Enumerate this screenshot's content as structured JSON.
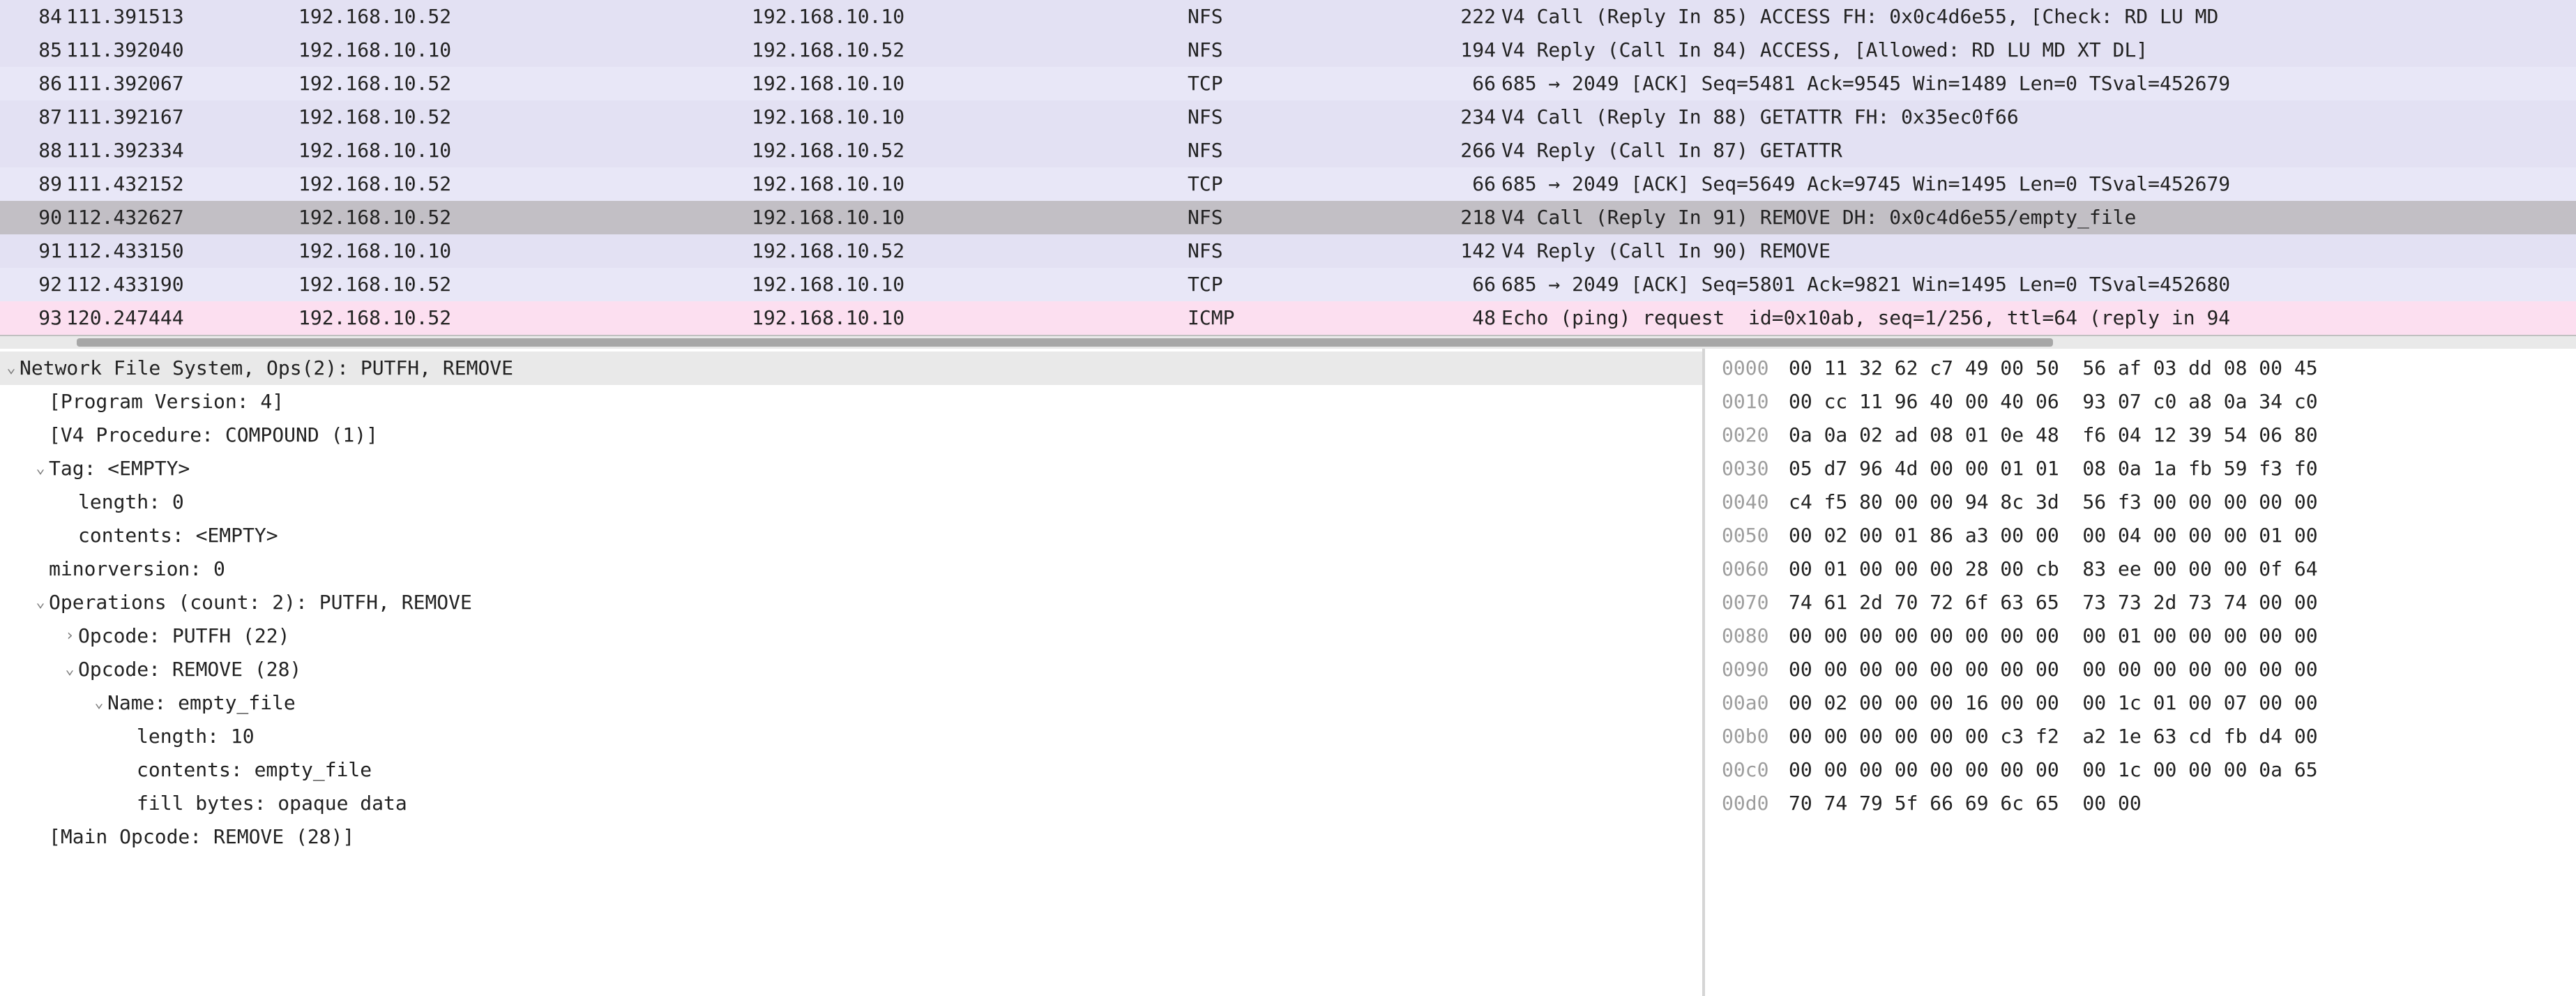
{
  "packets": [
    {
      "no": "84",
      "time": "111.391513",
      "src": "192.168.10.52",
      "dst": "192.168.10.10",
      "proto": "NFS",
      "len": "222",
      "info": "V4 Call (Reply In 85) ACCESS FH: 0x0c4d6e55, [Check: RD LU MD",
      "class": "nfs"
    },
    {
      "no": "85",
      "time": "111.392040",
      "src": "192.168.10.10",
      "dst": "192.168.10.52",
      "proto": "NFS",
      "len": "194",
      "info": "V4 Reply (Call In 84) ACCESS, [Allowed: RD LU MD XT DL]",
      "class": "nfs"
    },
    {
      "no": "86",
      "time": "111.392067",
      "src": "192.168.10.52",
      "dst": "192.168.10.10",
      "proto": "TCP",
      "len": "66",
      "info": "685 → 2049 [ACK] Seq=5481 Ack=9545 Win=1489 Len=0 TSval=452679",
      "class": "tcp"
    },
    {
      "no": "87",
      "time": "111.392167",
      "src": "192.168.10.52",
      "dst": "192.168.10.10",
      "proto": "NFS",
      "len": "234",
      "info": "V4 Call (Reply In 88) GETATTR FH: 0x35ec0f66",
      "class": "nfs"
    },
    {
      "no": "88",
      "time": "111.392334",
      "src": "192.168.10.10",
      "dst": "192.168.10.52",
      "proto": "NFS",
      "len": "266",
      "info": "V4 Reply (Call In 87) GETATTR",
      "class": "nfs"
    },
    {
      "no": "89",
      "time": "111.432152",
      "src": "192.168.10.52",
      "dst": "192.168.10.10",
      "proto": "TCP",
      "len": "66",
      "info": "685 → 2049 [ACK] Seq=5649 Ack=9745 Win=1495 Len=0 TSval=452679",
      "class": "tcp"
    },
    {
      "no": "90",
      "time": "112.432627",
      "src": "192.168.10.52",
      "dst": "192.168.10.10",
      "proto": "NFS",
      "len": "218",
      "info": "V4 Call (Reply In 91) REMOVE DH: 0x0c4d6e55/empty_file",
      "class": "selected"
    },
    {
      "no": "91",
      "time": "112.433150",
      "src": "192.168.10.10",
      "dst": "192.168.10.52",
      "proto": "NFS",
      "len": "142",
      "info": "V4 Reply (Call In 90) REMOVE",
      "class": "nfs"
    },
    {
      "no": "92",
      "time": "112.433190",
      "src": "192.168.10.52",
      "dst": "192.168.10.10",
      "proto": "TCP",
      "len": "66",
      "info": "685 → 2049 [ACK] Seq=5801 Ack=9821 Win=1495 Len=0 TSval=452680",
      "class": "tcp"
    },
    {
      "no": "93",
      "time": "120.247444",
      "src": "192.168.10.52",
      "dst": "192.168.10.10",
      "proto": "ICMP",
      "len": "48",
      "info": "Echo (ping) request  id=0x10ab, seq=1/256, ttl=64 (reply in 94",
      "class": "icmp"
    }
  ],
  "tree": [
    {
      "indent": 0,
      "caret": "down",
      "sel": true,
      "text": "Network File System, Ops(2): PUTFH, REMOVE"
    },
    {
      "indent": 1,
      "caret": "none",
      "sel": false,
      "text": "[Program Version: 4]"
    },
    {
      "indent": 1,
      "caret": "none",
      "sel": false,
      "text": "[V4 Procedure: COMPOUND (1)]"
    },
    {
      "indent": 1,
      "caret": "down",
      "sel": false,
      "text": "Tag: <EMPTY>"
    },
    {
      "indent": 2,
      "caret": "none",
      "sel": false,
      "text": "length: 0"
    },
    {
      "indent": 2,
      "caret": "none",
      "sel": false,
      "text": "contents: <EMPTY>"
    },
    {
      "indent": 1,
      "caret": "none",
      "sel": false,
      "text": "minorversion: 0"
    },
    {
      "indent": 1,
      "caret": "down",
      "sel": false,
      "text": "Operations (count: 2): PUTFH, REMOVE"
    },
    {
      "indent": 2,
      "caret": "right",
      "sel": false,
      "text": "Opcode: PUTFH (22)"
    },
    {
      "indent": 2,
      "caret": "down",
      "sel": false,
      "text": "Opcode: REMOVE (28)"
    },
    {
      "indent": 3,
      "caret": "down",
      "sel": false,
      "text": "Name: empty_file"
    },
    {
      "indent": 4,
      "caret": "none",
      "sel": false,
      "text": "length: 10"
    },
    {
      "indent": 4,
      "caret": "none",
      "sel": false,
      "text": "contents: empty_file"
    },
    {
      "indent": 4,
      "caret": "none",
      "sel": false,
      "text": "fill bytes: opaque data"
    },
    {
      "indent": 1,
      "caret": "none",
      "sel": false,
      "text": "[Main Opcode: REMOVE (28)]"
    }
  ],
  "hex": [
    {
      "off": "0000",
      "bytes": "00 11 32 62 c7 49 00 50  56 af 03 dd 08 00 45 "
    },
    {
      "off": "0010",
      "bytes": "00 cc 11 96 40 00 40 06  93 07 c0 a8 0a 34 c0 "
    },
    {
      "off": "0020",
      "bytes": "0a 0a 02 ad 08 01 0e 48  f6 04 12 39 54 06 80 "
    },
    {
      "off": "0030",
      "bytes": "05 d7 96 4d 00 00 01 01  08 0a 1a fb 59 f3 f0 "
    },
    {
      "off": "0040",
      "bytes": "c4 f5 80 00 00 94 8c 3d  56 f3 00 00 00 00 00 "
    },
    {
      "off": "0050",
      "bytes": "00 02 00 01 86 a3 00 00  00 04 00 00 00 01 00 "
    },
    {
      "off": "0060",
      "bytes": "00 01 00 00 00 28 00 cb  83 ee 00 00 00 0f 64 "
    },
    {
      "off": "0070",
      "bytes": "74 61 2d 70 72 6f 63 65  73 73 2d 73 74 00 00 "
    },
    {
      "off": "0080",
      "bytes": "00 00 00 00 00 00 00 00  00 01 00 00 00 00 00 "
    },
    {
      "off": "0090",
      "bytes": "00 00 00 00 00 00 00 00  00 00 00 00 00 00 00 "
    },
    {
      "off": "00a0",
      "bytes": "00 02 00 00 00 16 00 00  00 1c 01 00 07 00 00 "
    },
    {
      "off": "00b0",
      "bytes": "00 00 00 00 00 00 c3 f2  a2 1e 63 cd fb d4 00 "
    },
    {
      "off": "00c0",
      "bytes": "00 00 00 00 00 00 00 00  00 1c 00 00 00 0a 65 "
    },
    {
      "off": "00d0",
      "bytes": "70 74 79 5f 66 69 6c 65  00 00"
    }
  ]
}
